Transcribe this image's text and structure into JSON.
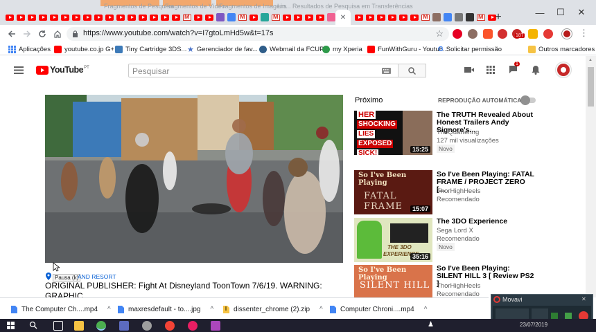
{
  "browser": {
    "tab_titles_faded": [
      "Fragmentos de Pesquisa",
      "Fragmentos de Vídeo",
      "Fragmentos de Imagens",
      "Fragmentos de Imagens",
      "Lin... Resultados de Pesquisa em Transferências"
    ],
    "new_tab_label": "+",
    "window_controls": {
      "minimize": "—",
      "maximize": "☐",
      "close": "✕"
    },
    "url": "https://www.youtube.com/watch?v=I7gtoLmHd5w&t=17s",
    "extension_badge": "187",
    "extension_badge_small": "4"
  },
  "bookmarks": {
    "items": [
      {
        "label": "Aplicações",
        "icon": "apps-grid-icon",
        "color": "#4285f4"
      },
      {
        "label": "youtube.co.jp G+",
        "icon": "youtube-icon",
        "color": "#ff0000"
      },
      {
        "label": "Tiny Cartridge 3DS...",
        "icon": "cartridge-icon",
        "color": "#3d7ab8"
      },
      {
        "label": "Gerenciador de fav...",
        "icon": "star-icon",
        "color": "#4a73c9"
      },
      {
        "label": "Webmail da FCUP",
        "icon": "webmail-icon",
        "color": "#2f5d89"
      },
      {
        "label": "my Xperia",
        "icon": "xperia-icon",
        "color": "#2e9a4a"
      },
      {
        "label": "FunWithGuru - Youtub...",
        "icon": "youtube-icon",
        "color": "#ff0000"
      },
      {
        "label": "Solicitar permissão",
        "icon": "google-icon",
        "color": "#4285f4"
      }
    ],
    "other_label": "Outros marcadores"
  },
  "youtube": {
    "logo_text": "YouTube",
    "logo_region": "PT",
    "search_placeholder": "Pesquisar",
    "notification_count": "1",
    "next_label": "Próximo",
    "autoplay_label": "REPRODUÇÃO AUTOMÁTICA"
  },
  "video": {
    "tooltip": "Pausa (k)",
    "location_text": "AND RESORT",
    "title": "ORIGINAL PUBLISHER: Fight At Disneyland ToonTown 7/6/19. WARNING: GRAPHIC"
  },
  "sidebar": {
    "items": [
      {
        "title": "The TRUTH Revealed About Honest Trailers Andy Signore's...",
        "channel": "TheQuartering",
        "meta": "127 mil visualizações",
        "badge": "Novo",
        "duration": "15:25",
        "thumb_text": [
          "HER",
          "SHOCKING",
          "LIES",
          "EXPOSED",
          "SICK!"
        ]
      },
      {
        "title": "So I've Been Playing: FATAL FRAME / PROJECT ZERO [...",
        "channel": "ThorHighHeels",
        "meta": "Recomendado",
        "badge": "",
        "duration": "15:07",
        "thumb_text": [
          "So I've Been Playing",
          "FATAL FRAME"
        ]
      },
      {
        "title": "The 3DO Experience",
        "channel": "Sega Lord X",
        "meta": "Recomendado",
        "badge": "Novo",
        "duration": "35:16",
        "thumb_text": [
          "THE 3DO",
          "EXPERIENCE"
        ]
      },
      {
        "title": "So I've Been Playing: SILENT HILL 3 [ Review PS2 ]",
        "channel": "ThorHighHeels",
        "meta": "Recomendado",
        "badge": "",
        "duration": "",
        "thumb_text": [
          "So I've Been Playing",
          "SILENT HILL"
        ]
      }
    ]
  },
  "downloads": {
    "items": [
      {
        "name": "The Computer Ch....mp4",
        "icon": "document-icon"
      },
      {
        "name": "maxresdefault - to....jpg",
        "icon": "document-icon"
      },
      {
        "name": "dissenter_chrome (2).zip",
        "icon": "zip-icon"
      },
      {
        "name": "Computer Chroni....mp4",
        "icon": "document-icon"
      }
    ]
  },
  "movavi": {
    "title": "Movavi"
  },
  "taskbar": {
    "clock": "23/07/2019"
  },
  "colors": {
    "youtube_red": "#ff0000",
    "tab_bg": "#dee1e6",
    "link_blue": "#065fd4"
  }
}
